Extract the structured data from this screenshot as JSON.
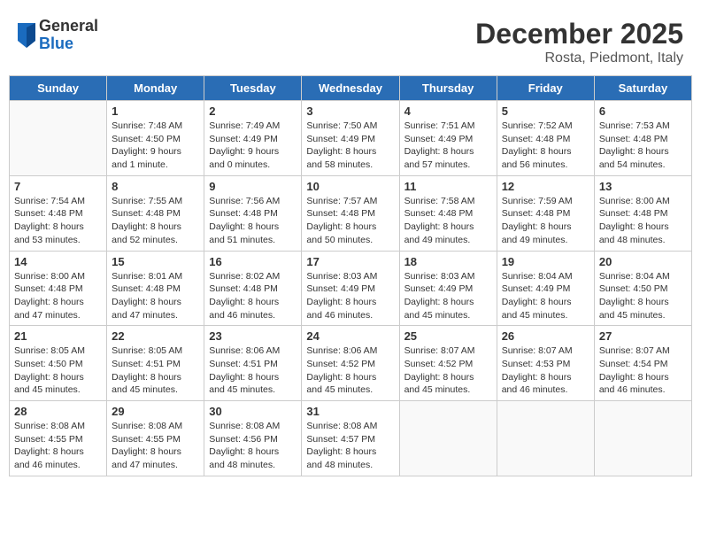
{
  "header": {
    "logo_general": "General",
    "logo_blue": "Blue",
    "month_title": "December 2025",
    "location": "Rosta, Piedmont, Italy"
  },
  "days_of_week": [
    "Sunday",
    "Monday",
    "Tuesday",
    "Wednesday",
    "Thursday",
    "Friday",
    "Saturday"
  ],
  "weeks": [
    [
      {
        "day": "",
        "info": ""
      },
      {
        "day": "1",
        "info": "Sunrise: 7:48 AM\nSunset: 4:50 PM\nDaylight: 9 hours\nand 1 minute."
      },
      {
        "day": "2",
        "info": "Sunrise: 7:49 AM\nSunset: 4:49 PM\nDaylight: 9 hours\nand 0 minutes."
      },
      {
        "day": "3",
        "info": "Sunrise: 7:50 AM\nSunset: 4:49 PM\nDaylight: 8 hours\nand 58 minutes."
      },
      {
        "day": "4",
        "info": "Sunrise: 7:51 AM\nSunset: 4:49 PM\nDaylight: 8 hours\nand 57 minutes."
      },
      {
        "day": "5",
        "info": "Sunrise: 7:52 AM\nSunset: 4:48 PM\nDaylight: 8 hours\nand 56 minutes."
      },
      {
        "day": "6",
        "info": "Sunrise: 7:53 AM\nSunset: 4:48 PM\nDaylight: 8 hours\nand 54 minutes."
      }
    ],
    [
      {
        "day": "7",
        "info": "Sunrise: 7:54 AM\nSunset: 4:48 PM\nDaylight: 8 hours\nand 53 minutes."
      },
      {
        "day": "8",
        "info": "Sunrise: 7:55 AM\nSunset: 4:48 PM\nDaylight: 8 hours\nand 52 minutes."
      },
      {
        "day": "9",
        "info": "Sunrise: 7:56 AM\nSunset: 4:48 PM\nDaylight: 8 hours\nand 51 minutes."
      },
      {
        "day": "10",
        "info": "Sunrise: 7:57 AM\nSunset: 4:48 PM\nDaylight: 8 hours\nand 50 minutes."
      },
      {
        "day": "11",
        "info": "Sunrise: 7:58 AM\nSunset: 4:48 PM\nDaylight: 8 hours\nand 49 minutes."
      },
      {
        "day": "12",
        "info": "Sunrise: 7:59 AM\nSunset: 4:48 PM\nDaylight: 8 hours\nand 49 minutes."
      },
      {
        "day": "13",
        "info": "Sunrise: 8:00 AM\nSunset: 4:48 PM\nDaylight: 8 hours\nand 48 minutes."
      }
    ],
    [
      {
        "day": "14",
        "info": "Sunrise: 8:00 AM\nSunset: 4:48 PM\nDaylight: 8 hours\nand 47 minutes."
      },
      {
        "day": "15",
        "info": "Sunrise: 8:01 AM\nSunset: 4:48 PM\nDaylight: 8 hours\nand 47 minutes."
      },
      {
        "day": "16",
        "info": "Sunrise: 8:02 AM\nSunset: 4:48 PM\nDaylight: 8 hours\nand 46 minutes."
      },
      {
        "day": "17",
        "info": "Sunrise: 8:03 AM\nSunset: 4:49 PM\nDaylight: 8 hours\nand 46 minutes."
      },
      {
        "day": "18",
        "info": "Sunrise: 8:03 AM\nSunset: 4:49 PM\nDaylight: 8 hours\nand 45 minutes."
      },
      {
        "day": "19",
        "info": "Sunrise: 8:04 AM\nSunset: 4:49 PM\nDaylight: 8 hours\nand 45 minutes."
      },
      {
        "day": "20",
        "info": "Sunrise: 8:04 AM\nSunset: 4:50 PM\nDaylight: 8 hours\nand 45 minutes."
      }
    ],
    [
      {
        "day": "21",
        "info": "Sunrise: 8:05 AM\nSunset: 4:50 PM\nDaylight: 8 hours\nand 45 minutes."
      },
      {
        "day": "22",
        "info": "Sunrise: 8:05 AM\nSunset: 4:51 PM\nDaylight: 8 hours\nand 45 minutes."
      },
      {
        "day": "23",
        "info": "Sunrise: 8:06 AM\nSunset: 4:51 PM\nDaylight: 8 hours\nand 45 minutes."
      },
      {
        "day": "24",
        "info": "Sunrise: 8:06 AM\nSunset: 4:52 PM\nDaylight: 8 hours\nand 45 minutes."
      },
      {
        "day": "25",
        "info": "Sunrise: 8:07 AM\nSunset: 4:52 PM\nDaylight: 8 hours\nand 45 minutes."
      },
      {
        "day": "26",
        "info": "Sunrise: 8:07 AM\nSunset: 4:53 PM\nDaylight: 8 hours\nand 46 minutes."
      },
      {
        "day": "27",
        "info": "Sunrise: 8:07 AM\nSunset: 4:54 PM\nDaylight: 8 hours\nand 46 minutes."
      }
    ],
    [
      {
        "day": "28",
        "info": "Sunrise: 8:08 AM\nSunset: 4:55 PM\nDaylight: 8 hours\nand 46 minutes."
      },
      {
        "day": "29",
        "info": "Sunrise: 8:08 AM\nSunset: 4:55 PM\nDaylight: 8 hours\nand 47 minutes."
      },
      {
        "day": "30",
        "info": "Sunrise: 8:08 AM\nSunset: 4:56 PM\nDaylight: 8 hours\nand 48 minutes."
      },
      {
        "day": "31",
        "info": "Sunrise: 8:08 AM\nSunset: 4:57 PM\nDaylight: 8 hours\nand 48 minutes."
      },
      {
        "day": "",
        "info": ""
      },
      {
        "day": "",
        "info": ""
      },
      {
        "day": "",
        "info": ""
      }
    ]
  ]
}
